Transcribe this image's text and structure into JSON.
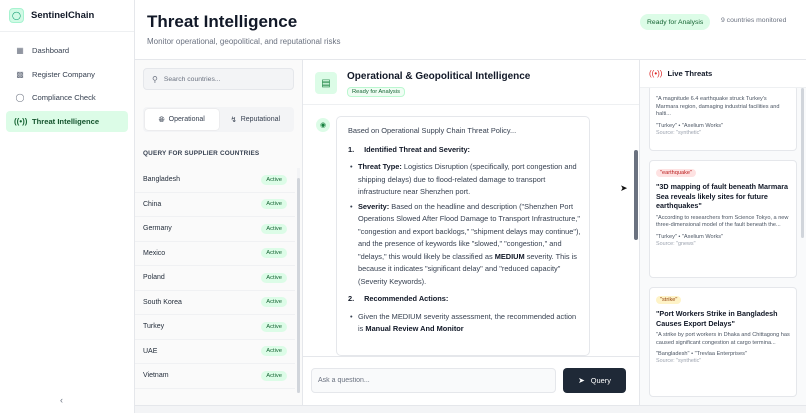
{
  "brand": {
    "name": "SentinelChain",
    "logo_icon": "shield-icon"
  },
  "sidebar": {
    "items": [
      {
        "label": "Dashboard",
        "icon": "grid-icon",
        "active": false
      },
      {
        "label": "Register Company",
        "icon": "building-icon",
        "active": false
      },
      {
        "label": "Compliance Check",
        "icon": "shield-check-icon",
        "active": false
      },
      {
        "label": "Threat Intelligence",
        "icon": "radio-tower-icon",
        "active": true
      }
    ],
    "collapse_icon": "chevron-left-icon"
  },
  "header": {
    "title": "Threat Intelligence",
    "subtitle": "Monitor operational, geopolitical, and reputational risks",
    "status": "Ready for Analysis",
    "countries_monitored": "9 countries monitored"
  },
  "countries_panel": {
    "search_placeholder": "Search countries...",
    "tabs": [
      {
        "label": "Operational",
        "icon": "globe-icon",
        "active": true
      },
      {
        "label": "Reputational",
        "icon": "activity-icon",
        "active": false
      }
    ],
    "list_header": "QUERY FOR SUPPLIER COUNTRIES",
    "countries": [
      {
        "name": "Bangladesh",
        "status": "Active"
      },
      {
        "name": "China",
        "status": "Active"
      },
      {
        "name": "Germany",
        "status": "Active"
      },
      {
        "name": "Mexico",
        "status": "Active"
      },
      {
        "name": "Poland",
        "status": "Active"
      },
      {
        "name": "South Korea",
        "status": "Active"
      },
      {
        "name": "Turkey",
        "status": "Active"
      },
      {
        "name": "UAE",
        "status": "Active"
      },
      {
        "name": "Vietnam",
        "status": "Active"
      }
    ]
  },
  "main": {
    "title": "Operational & Geopolitical Intelligence",
    "status": "Ready for Analysis",
    "message": {
      "intro": "Based on Operational Supply Chain Threat Policy...",
      "section1_num": "1.",
      "section1_title": "Identified Threat and Severity:",
      "threat_type_label": "Threat Type:",
      "threat_type_text": " Logistics Disruption (specifically, port congestion and shipping delays) due to flood-related damage to transport infrastructure near Shenzhen port.",
      "severity_label": "Severity:",
      "severity_text_1": " Based on the headline and description (\"Shenzhen Port Operations Slowed After Flood Damage to Transport Infrastructure,\" \"congestion and export backlogs,\" \"shipment delays may continue\"), and the presence of keywords like \"slowed,\" \"congestion,\" and \"delays,\" this would likely be classified as ",
      "severity_level": "MEDIUM",
      "severity_text_2": " severity. This is because it indicates \"significant delay\" and \"reduced capacity\" (Severity Keywords).",
      "section2_num": "2.",
      "section2_title": "Recommended Actions:",
      "action_text": "Given the MEDIUM severity assessment, the recommended action is ",
      "action_value": "Manual Review And Monitor"
    },
    "input_placeholder": "Ask a question...",
    "query_button": "Query"
  },
  "live_threats": {
    "title": "Live Threats",
    "cards": [
      {
        "tag": "",
        "headline": "",
        "quote": "\"A magnitude 6.4 earthquake struck Turkey's Marmara region, damaging industrial facilities and halti...",
        "entities": "\"Turkey\" • \"Axelium Works\"",
        "source": "Source: \"synthetic\""
      },
      {
        "tag": "\"earthquake\"",
        "headline": "\"3D mapping of fault beneath Marmara Sea reveals likely sites for future earthquakes\"",
        "quote": "\"According to researchers from Science Tokyo, a new three-dimensional model of the fault beneath the...",
        "entities": "\"Turkey\" • \"Axelium Works\"",
        "source": "Source: \"gnews\""
      },
      {
        "tag": "\"strike\"",
        "headline": "\"Port Workers Strike in Bangladesh Causes Export Delays\"",
        "quote": "\"A strike by port workers in Dhaka and Chittagong has caused significant congestion at cargo termina...",
        "entities": "\"Bangladesh\" • \"Trevlaa Enterprises\"",
        "source": "Source: \"synthetic\""
      }
    ]
  },
  "colors": {
    "accent": "#16a34a",
    "accent_bg": "#dcfce7",
    "dark_button": "#1f2937"
  }
}
